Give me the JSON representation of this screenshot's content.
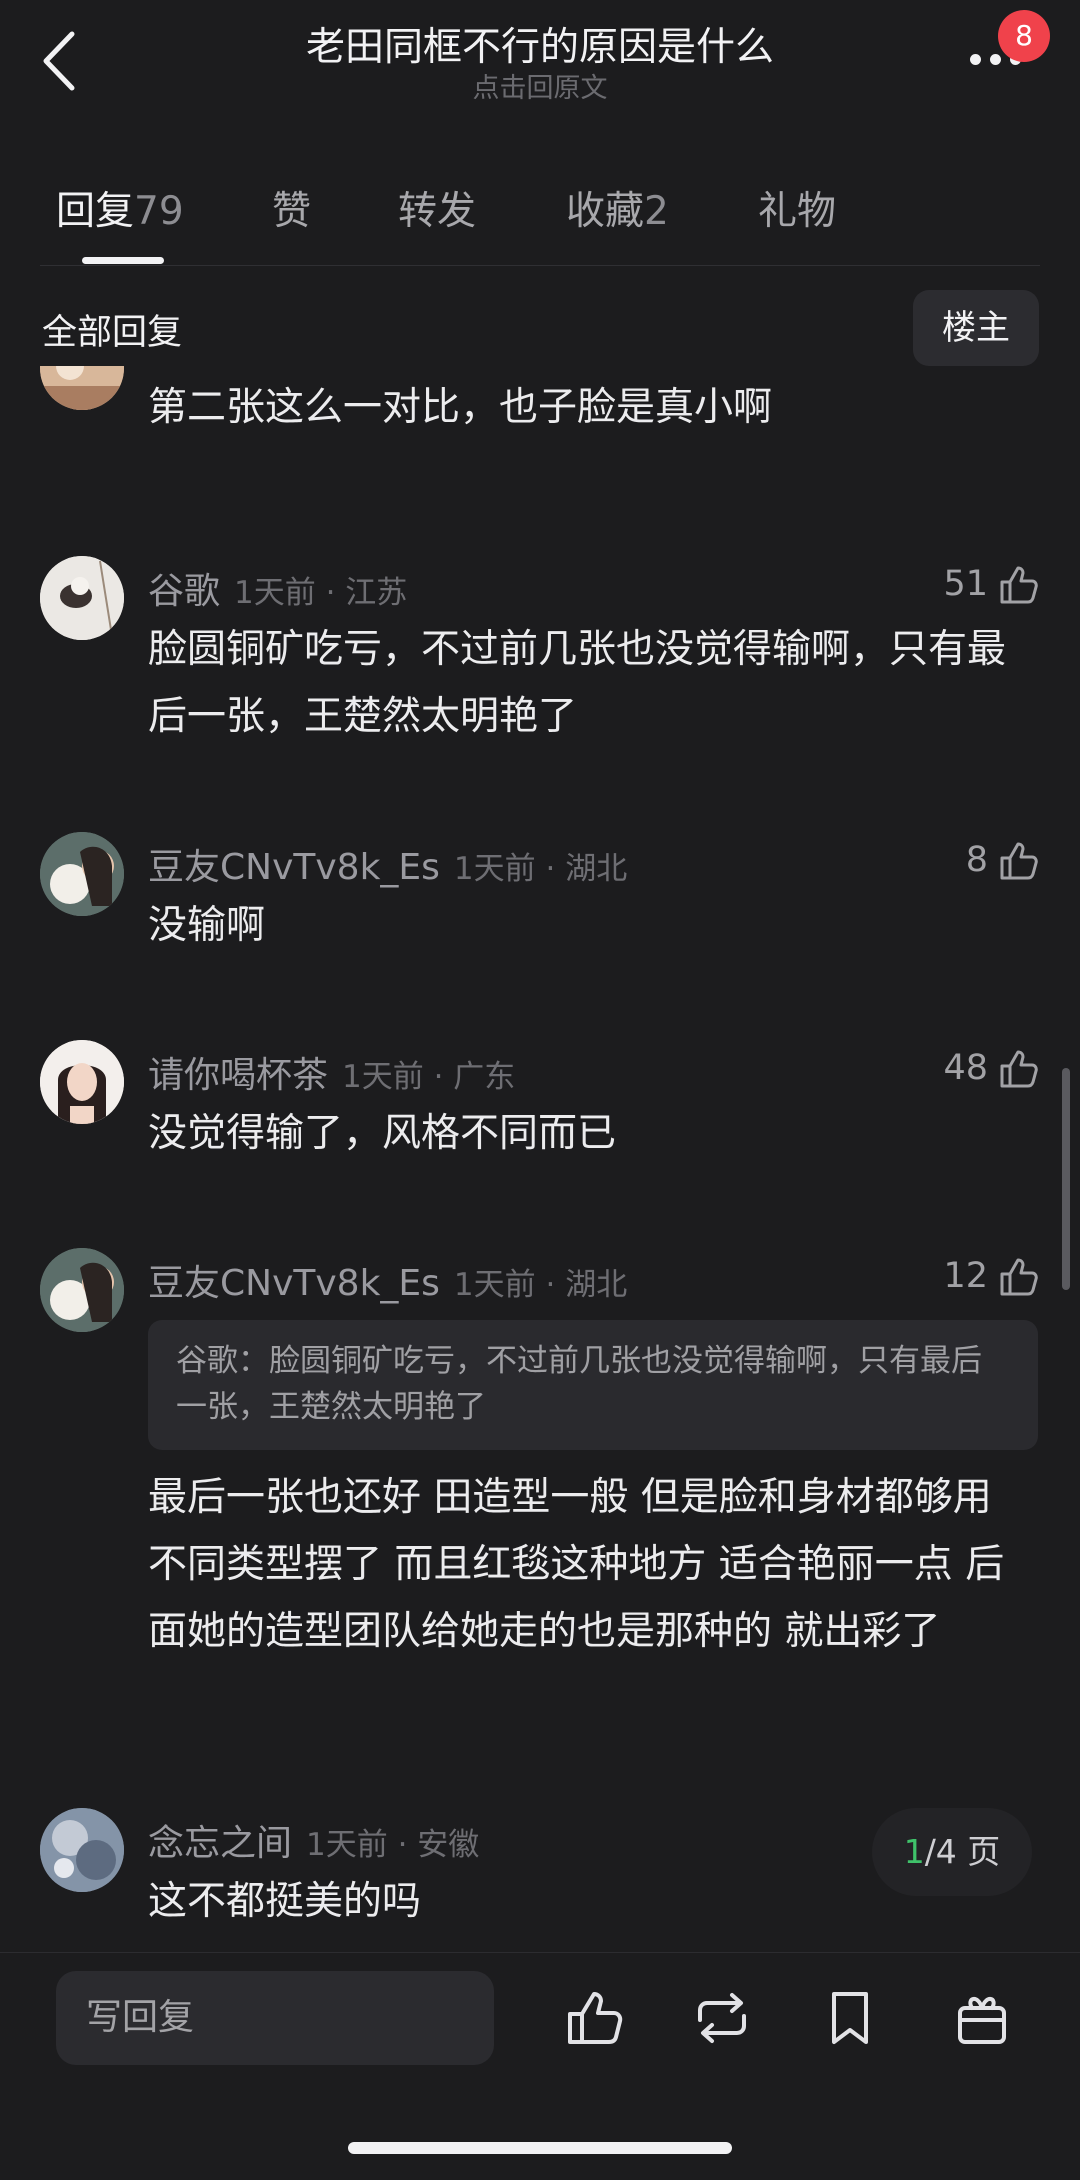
{
  "header": {
    "title": "老田同框不行的原因是什么",
    "subtitle": "点击回原文",
    "badge_count": "8"
  },
  "tabs": [
    {
      "label": "回复",
      "count": "79",
      "active": true
    },
    {
      "label": "赞",
      "count": ""
    },
    {
      "label": "转发",
      "count": ""
    },
    {
      "label": "收藏",
      "count": "2"
    },
    {
      "label": "礼物",
      "count": ""
    }
  ],
  "section": {
    "title": "全部回复",
    "op_filter_label": "楼主"
  },
  "comments": [
    {
      "body": "第二张这么一对比，也子脸是真小啊"
    },
    {
      "user": "谷歌",
      "time": "1天前 · 江苏",
      "likes": "51",
      "body": "脸圆铜矿吃亏，不过前几张也没觉得输啊，只有最后一张，王楚然太明艳了"
    },
    {
      "user": "豆友CNvTv8k_Es",
      "time": "1天前 · 湖北",
      "likes": "8",
      "body": "没输啊"
    },
    {
      "user": "请你喝杯茶",
      "time": "1天前 · 广东",
      "likes": "48",
      "body": "没觉得输了，风格不同而已"
    },
    {
      "user": "豆友CNvTv8k_Es",
      "time": "1天前 · 湖北",
      "likes": "12",
      "quote": "谷歌：脸圆铜矿吃亏，不过前几张也没觉得输啊，只有最后一张，王楚然太明艳了",
      "body": "最后一张也还好 田造型一般 但是脸和身材都够用 不同类型摆了 而且红毯这种地方 适合艳丽一点 后面她的造型团队给她走的也是那种的 就出彩了"
    },
    {
      "user": "念忘之间",
      "time": "1天前 · 安徽",
      "body": "这不都挺美的吗"
    }
  ],
  "pager": {
    "current": "1",
    "total_label": "/4 页"
  },
  "bottom_bar": {
    "reply_placeholder": "写回复",
    "icons": [
      "thumbs-up-icon",
      "repost-icon",
      "bookmark-icon",
      "gift-icon"
    ]
  },
  "colors": {
    "background": "#1c1c1e",
    "badge": "#f0424b",
    "pager_current": "#3fc26a"
  }
}
